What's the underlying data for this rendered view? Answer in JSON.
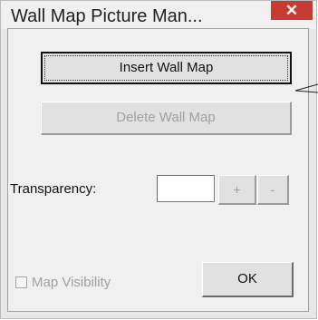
{
  "window": {
    "title": "Wall Map Picture Man...",
    "close_label": "✕"
  },
  "buttons": {
    "insert_label": "Insert Wall Map",
    "delete_label": "Delete Wall Map",
    "plus_label": "+",
    "minus_label": "-",
    "ok_label": "OK"
  },
  "transparency": {
    "label": "Transparency:",
    "value": ""
  },
  "visibility": {
    "label": "Map Visibility",
    "checked": false
  },
  "colors": {
    "close_button": "#c73b32",
    "dialog_bg": "#f0f0f0",
    "disabled_text": "#a0a0a0"
  },
  "icons": [
    "close-icon",
    "arrow-pointer-icon"
  ]
}
